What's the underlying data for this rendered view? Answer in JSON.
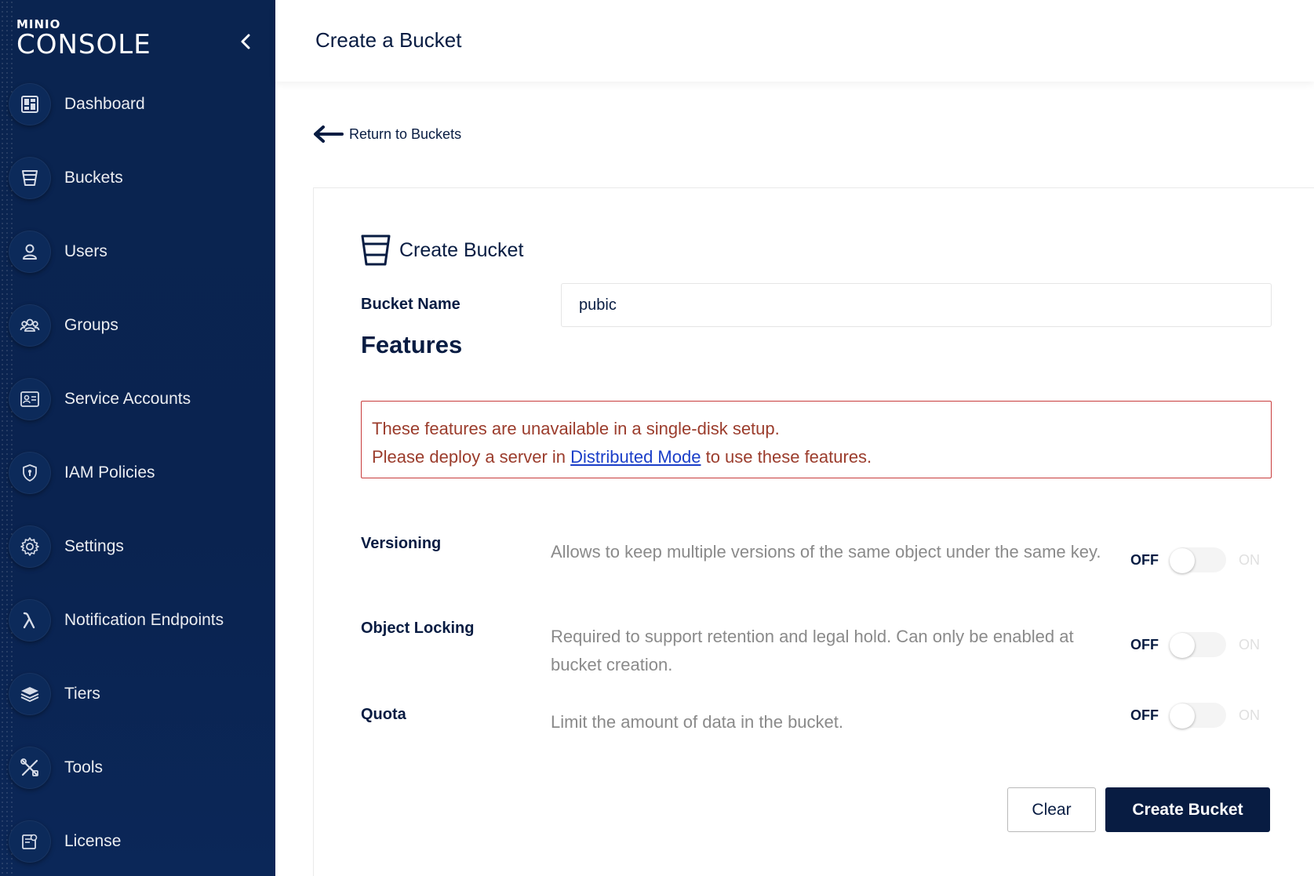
{
  "app": {
    "logo_small": "MINIO",
    "logo_large": "CONSOLE"
  },
  "sidebar": {
    "items": [
      {
        "label": "Dashboard",
        "icon": "dashboard-icon"
      },
      {
        "label": "Buckets",
        "icon": "bucket-icon"
      },
      {
        "label": "Users",
        "icon": "user-icon"
      },
      {
        "label": "Groups",
        "icon": "groups-icon"
      },
      {
        "label": "Service Accounts",
        "icon": "service-accounts-icon"
      },
      {
        "label": "IAM Policies",
        "icon": "shield-icon"
      },
      {
        "label": "Settings",
        "icon": "gear-icon"
      },
      {
        "label": "Notification Endpoints",
        "icon": "lambda-icon"
      },
      {
        "label": "Tiers",
        "icon": "layers-icon"
      },
      {
        "label": "Tools",
        "icon": "tools-icon"
      },
      {
        "label": "License",
        "icon": "license-icon"
      }
    ]
  },
  "header": {
    "title": "Create a Bucket"
  },
  "back_link": {
    "label": "Return to Buckets"
  },
  "form": {
    "title": "Create Bucket",
    "bucket_name_label": "Bucket Name",
    "bucket_name_value": "pubic",
    "features_title": "Features",
    "warning": {
      "line1": "These features are unavailable in a single-disk setup.",
      "line2_prefix": "Please deploy a server in",
      "line2_link": "Distributed Mode",
      "line2_suffix": "to use these features."
    },
    "features": [
      {
        "name": "Versioning",
        "description": "Allows to keep multiple versions of the same object under the same key.",
        "off_label": "OFF",
        "on_label": "ON",
        "enabled": false
      },
      {
        "name": "Object Locking",
        "description": "Required to support retention and legal hold. Can only be enabled at bucket creation.",
        "off_label": "OFF",
        "on_label": "ON",
        "enabled": false
      },
      {
        "name": "Quota",
        "description": "Limit the amount of data in the bucket.",
        "off_label": "OFF",
        "on_label": "ON",
        "enabled": false
      }
    ],
    "clear_label": "Clear",
    "create_label": "Create Bucket"
  },
  "colors": {
    "sidebar_bg": "#0a2450",
    "primary": "#081c42",
    "warning_border": "#c83c3c",
    "warning_text": "#9b3c2c",
    "link": "#1a3ec8"
  }
}
